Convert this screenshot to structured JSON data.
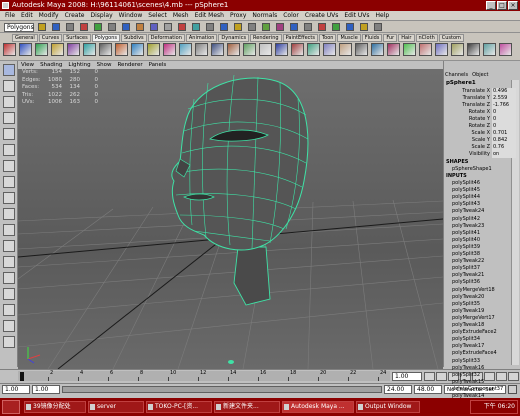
{
  "window": {
    "title": "Autodesk Maya 2008: H:\\96114061\\scenes\\4.mb    ---    pSphere1"
  },
  "menubar": [
    "File",
    "Edit",
    "Modify",
    "Create",
    "Display",
    "Window",
    "Select",
    "Mesh",
    "Edit Mesh",
    "Proxy",
    "Normals",
    "Color",
    "Create UVs",
    "Edit UVs",
    "Help"
  ],
  "statusline": {
    "mode": "Polygons"
  },
  "shelf": {
    "tabs": [
      "General",
      "Curves",
      "Surfaces",
      "Polygons",
      "Subdivs",
      "Deformation",
      "Animation",
      "Dynamics",
      "Rendering",
      "PaintEffects",
      "Toon",
      "Muscle",
      "Fluids",
      "Fur",
      "Hair",
      "nCloth",
      "Custom"
    ],
    "active": "Polygons"
  },
  "panelmenu": [
    "View",
    "Shading",
    "Lighting",
    "Show",
    "Renderer",
    "Panels"
  ],
  "hud": {
    "rows": [
      {
        "label": "Verts:",
        "v1": "154",
        "v2": "152",
        "v3": "0"
      },
      {
        "label": "Edges:",
        "v1": "1080",
        "v2": "280",
        "v3": "0"
      },
      {
        "label": "Faces:",
        "v1": "534",
        "v2": "134",
        "v3": "0"
      },
      {
        "label": "Tris:",
        "v1": "1022",
        "v2": "262",
        "v3": "0"
      },
      {
        "label": "UVs:",
        "v1": "1006",
        "v2": "163",
        "v3": "0"
      }
    ]
  },
  "channelbox": {
    "menu": [
      "Channels",
      "Object"
    ],
    "object": "pSphere1",
    "attrs": [
      {
        "name": "Translate X",
        "value": "0.496"
      },
      {
        "name": "Translate Y",
        "value": "2.559"
      },
      {
        "name": "Translate Z",
        "value": "-1.766"
      },
      {
        "name": "Rotate X",
        "value": "0"
      },
      {
        "name": "Rotate Y",
        "value": "0"
      },
      {
        "name": "Rotate Z",
        "value": "0"
      },
      {
        "name": "Scale X",
        "value": "0.701"
      },
      {
        "name": "Scale Y",
        "value": "0.842"
      },
      {
        "name": "Scale Z",
        "value": "0.76"
      },
      {
        "name": "Visibility",
        "value": "on"
      }
    ],
    "shapes_label": "SHAPES",
    "shape": "pSphereShape1",
    "inputs_label": "INPUTS",
    "inputs": [
      "polySplit46",
      "polySplit45",
      "polySplit44",
      "polySplit43",
      "polyTweak24",
      "polySplit42",
      "polyTweak23",
      "polySplit41",
      "polySplit40",
      "polySplit39",
      "polySplit38",
      "polyTweak22",
      "polySplit37",
      "polyTweak21",
      "polySplit36",
      "polyMergeVert18",
      "polyTweak20",
      "polySplit35",
      "polyTweak19",
      "polyMergeVert17",
      "polyTweak18",
      "polyExtrudeFace2",
      "polySplit34",
      "polyTweak17",
      "polyExtrudeFace4",
      "polySplit33",
      "polyTweak16",
      "polySplit32",
      "polyTweak15",
      "deleteComponent37",
      "polyTweak14"
    ]
  },
  "timeslider": {
    "ticks": [
      "2",
      "4",
      "6",
      "8",
      "10",
      "12",
      "14",
      "16",
      "18",
      "20",
      "22",
      "24"
    ],
    "current_frame": "1.00",
    "start": "1.00",
    "range_start": "1.00",
    "range_end": "24.00",
    "end": "48.00",
    "character_set": "No Character Set"
  },
  "taskbar": {
    "tasks": [
      "39镜像分配处",
      "server",
      "TOKO-PC-[资...",
      "新建文件夹...",
      "Autodesk Maya ...",
      "Output Window"
    ],
    "clock": "下午 06:20"
  }
}
